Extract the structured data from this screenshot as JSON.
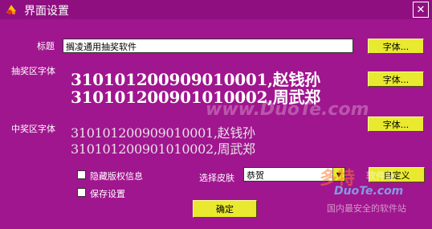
{
  "window": {
    "title": "界面设置",
    "close_symbol": "✕"
  },
  "title_row": {
    "label": "标题",
    "value": "搁凌通用抽奖软件",
    "font_button": "字体..."
  },
  "prize_area": {
    "label": "抽奖区字体",
    "lines": [
      "310101200909010001,赵钱孙",
      "310101200901010002,周武郑"
    ],
    "font_button": "字体..."
  },
  "winner_area": {
    "label": "中奖区字体",
    "lines": [
      "310101200909010001,赵钱孙",
      "310101200901010002,周武郑"
    ],
    "font_button": "字体..."
  },
  "options": {
    "hide_copyright": "隐藏版权信息",
    "save_settings": "保存设置"
  },
  "skin": {
    "label": "选择皮肤",
    "value": "恭贺",
    "custom_button": "自定义"
  },
  "ok_button": "确定",
  "watermarks": {
    "center": "www.DuoTe.com",
    "logo_cn": "多特",
    "logo_tail": "软件站",
    "logo_en": "DuoTe.com",
    "tagline": "国内最安全的软件站"
  },
  "colors": {
    "background": "#a0168e",
    "button": "#e9e930"
  }
}
